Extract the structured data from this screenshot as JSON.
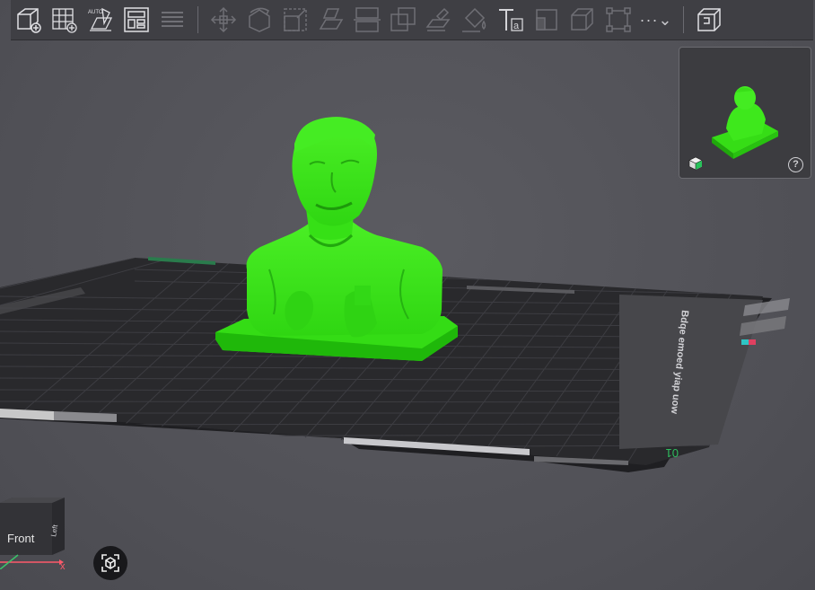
{
  "toolbar": {
    "buttons": [
      {
        "name": "add-object-icon"
      },
      {
        "name": "add-plate-icon"
      },
      {
        "name": "auto-orient-icon"
      },
      {
        "name": "arrange-layout-icon"
      },
      {
        "name": "slice-plate-icon"
      },
      {
        "name": "move-icon"
      },
      {
        "name": "rotate-icon"
      },
      {
        "name": "scale-icon"
      },
      {
        "name": "lay-on-face-icon"
      },
      {
        "name": "cut-icon"
      },
      {
        "name": "boolean-icon"
      },
      {
        "name": "support-paint-icon"
      },
      {
        "name": "color-paint-icon"
      },
      {
        "name": "text-icon"
      },
      {
        "name": "measure-icon"
      },
      {
        "name": "assembly-icon"
      },
      {
        "name": "bounding-box-icon"
      }
    ],
    "more_label": "···⌄",
    "text_tool_glyph": "Ta"
  },
  "thumbnail": {
    "help_label": "?"
  },
  "plate": {
    "right_text": "Bdqe emoed yiap uow",
    "bottom_label": "01"
  },
  "navcube": {
    "front_label": "Front",
    "axis_x_label": "x",
    "side_text": "Left"
  },
  "colors": {
    "model": "#3ee81c",
    "background": "#54545a",
    "toolbar": "#3f3f44",
    "plate": "#28282b",
    "grid": "#3c3c40"
  }
}
